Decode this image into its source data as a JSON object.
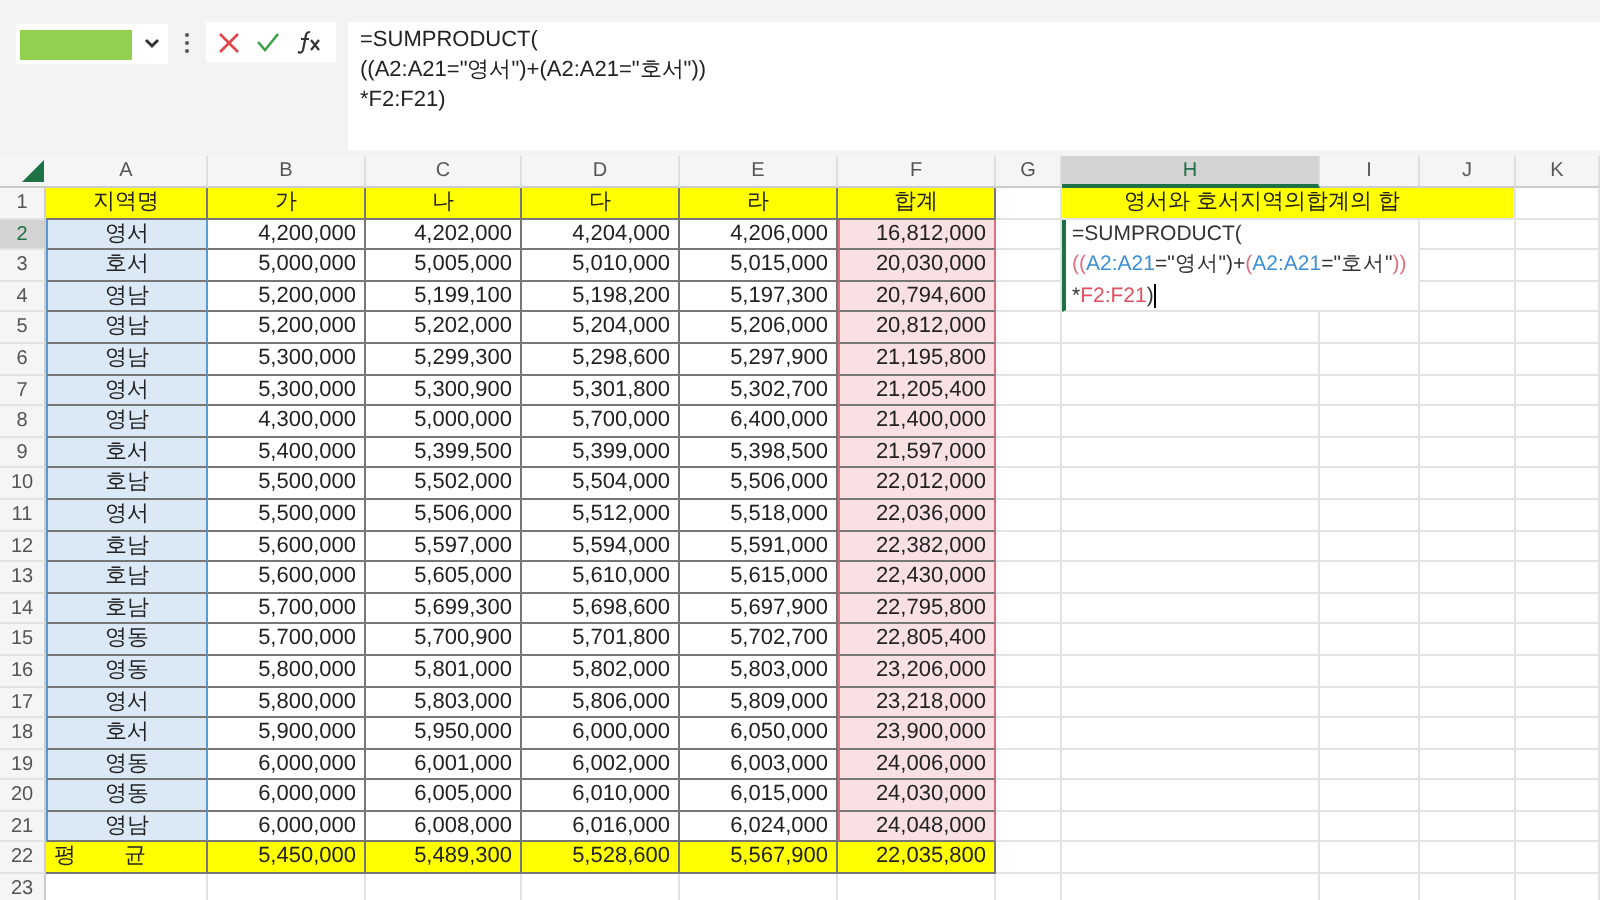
{
  "formula_bar": {
    "lines": [
      "=SUMPRODUCT(",
      "((A2:A21=\"영서\")+(A2:A21=\"호서\"))",
      "*F2:F21)"
    ]
  },
  "sheet": {
    "columns": [
      {
        "letter": "A",
        "selected": false,
        "color": "#5b9bd5"
      },
      {
        "letter": "B",
        "selected": false
      },
      {
        "letter": "C",
        "selected": false
      },
      {
        "letter": "D",
        "selected": false
      },
      {
        "letter": "E",
        "selected": false
      },
      {
        "letter": "F",
        "selected": false,
        "color": "#e07080"
      },
      {
        "letter": "G",
        "selected": false
      },
      {
        "letter": "H",
        "selected": true
      },
      {
        "letter": "I",
        "selected": false
      },
      {
        "letter": "J",
        "selected": false
      },
      {
        "letter": "K",
        "selected": false
      }
    ],
    "title": "영서와 호서지역의합계의 합",
    "editor": [
      [
        {
          "text": "=SUMPRODUCT(",
          "color": "#333333"
        }
      ],
      [
        {
          "text": "((",
          "color": "#e07080"
        },
        {
          "text": "A2:A21",
          "color": "#3d8fd6"
        },
        {
          "text": "=\"영서\")+",
          "color": "#333333"
        },
        {
          "text": "(",
          "color": "#e07080"
        },
        {
          "text": "A2:A21",
          "color": "#3d8fd6"
        },
        {
          "text": "=\"호서\"",
          "color": "#333333"
        },
        {
          "text": "))",
          "color": "#e07080"
        }
      ],
      [
        {
          "text": "*",
          "color": "#333333"
        },
        {
          "text": "F2:F21",
          "color": "#e05060"
        },
        {
          "text": ")",
          "color": "#333333"
        }
      ]
    ],
    "rows": [
      {
        "number": "1",
        "selected": false,
        "kind": "header",
        "cells": [
          "지역명",
          "가",
          "나",
          "다",
          "라",
          "합계"
        ]
      },
      {
        "number": "2",
        "selected": true,
        "kind": "data",
        "cells": [
          "영서",
          "4,200,000",
          "4,202,000",
          "4,204,000",
          "4,206,000",
          "16,812,000"
        ]
      },
      {
        "number": "3",
        "selected": false,
        "kind": "data",
        "cells": [
          "호서",
          "5,000,000",
          "5,005,000",
          "5,010,000",
          "5,015,000",
          "20,030,000"
        ]
      },
      {
        "number": "4",
        "selected": false,
        "kind": "data",
        "cells": [
          "영남",
          "5,200,000",
          "5,199,100",
          "5,198,200",
          "5,197,300",
          "20,794,600"
        ]
      },
      {
        "number": "5",
        "selected": false,
        "kind": "data",
        "cells": [
          "영남",
          "5,200,000",
          "5,202,000",
          "5,204,000",
          "5,206,000",
          "20,812,000"
        ]
      },
      {
        "number": "6",
        "selected": false,
        "kind": "data",
        "cells": [
          "영남",
          "5,300,000",
          "5,299,300",
          "5,298,600",
          "5,297,900",
          "21,195,800"
        ]
      },
      {
        "number": "7",
        "selected": false,
        "kind": "data",
        "cells": [
          "영서",
          "5,300,000",
          "5,300,900",
          "5,301,800",
          "5,302,700",
          "21,205,400"
        ]
      },
      {
        "number": "8",
        "selected": false,
        "kind": "data",
        "cells": [
          "영남",
          "4,300,000",
          "5,000,000",
          "5,700,000",
          "6,400,000",
          "21,400,000"
        ]
      },
      {
        "number": "9",
        "selected": false,
        "kind": "data",
        "cells": [
          "호서",
          "5,400,000",
          "5,399,500",
          "5,399,000",
          "5,398,500",
          "21,597,000"
        ]
      },
      {
        "number": "10",
        "selected": false,
        "kind": "data",
        "cells": [
          "호남",
          "5,500,000",
          "5,502,000",
          "5,504,000",
          "5,506,000",
          "22,012,000"
        ]
      },
      {
        "number": "11",
        "selected": false,
        "kind": "data",
        "cells": [
          "영서",
          "5,500,000",
          "5,506,000",
          "5,512,000",
          "5,518,000",
          "22,036,000"
        ]
      },
      {
        "number": "12",
        "selected": false,
        "kind": "data",
        "cells": [
          "호남",
          "5,600,000",
          "5,597,000",
          "5,594,000",
          "5,591,000",
          "22,382,000"
        ]
      },
      {
        "number": "13",
        "selected": false,
        "kind": "data",
        "cells": [
          "호남",
          "5,600,000",
          "5,605,000",
          "5,610,000",
          "5,615,000",
          "22,430,000"
        ]
      },
      {
        "number": "14",
        "selected": false,
        "kind": "data",
        "cells": [
          "호남",
          "5,700,000",
          "5,699,300",
          "5,698,600",
          "5,697,900",
          "22,795,800"
        ]
      },
      {
        "number": "15",
        "selected": false,
        "kind": "data",
        "cells": [
          "영동",
          "5,700,000",
          "5,700,900",
          "5,701,800",
          "5,702,700",
          "22,805,400"
        ]
      },
      {
        "number": "16",
        "selected": false,
        "kind": "data",
        "cells": [
          "영동",
          "5,800,000",
          "5,801,000",
          "5,802,000",
          "5,803,000",
          "23,206,000"
        ]
      },
      {
        "number": "17",
        "selected": false,
        "kind": "data",
        "cells": [
          "영서",
          "5,800,000",
          "5,803,000",
          "5,806,000",
          "5,809,000",
          "23,218,000"
        ]
      },
      {
        "number": "18",
        "selected": false,
        "kind": "data",
        "cells": [
          "호서",
          "5,900,000",
          "5,950,000",
          "6,000,000",
          "6,050,000",
          "23,900,000"
        ]
      },
      {
        "number": "19",
        "selected": false,
        "kind": "data",
        "cells": [
          "영동",
          "6,000,000",
          "6,001,000",
          "6,002,000",
          "6,003,000",
          "24,006,000"
        ]
      },
      {
        "number": "20",
        "selected": false,
        "kind": "data",
        "cells": [
          "영동",
          "6,000,000",
          "6,005,000",
          "6,010,000",
          "6,015,000",
          "24,030,000"
        ]
      },
      {
        "number": "21",
        "selected": false,
        "kind": "data",
        "cells": [
          "영남",
          "6,000,000",
          "6,008,000",
          "6,016,000",
          "6,024,000",
          "24,048,000"
        ]
      },
      {
        "number": "22",
        "selected": false,
        "kind": "total",
        "cells": [
          "평 균",
          "5,450,000",
          "5,489,300",
          "5,528,600",
          "5,567,900",
          "22,035,800"
        ]
      },
      {
        "number": "23",
        "selected": false,
        "kind": "blank",
        "cells": []
      }
    ]
  }
}
